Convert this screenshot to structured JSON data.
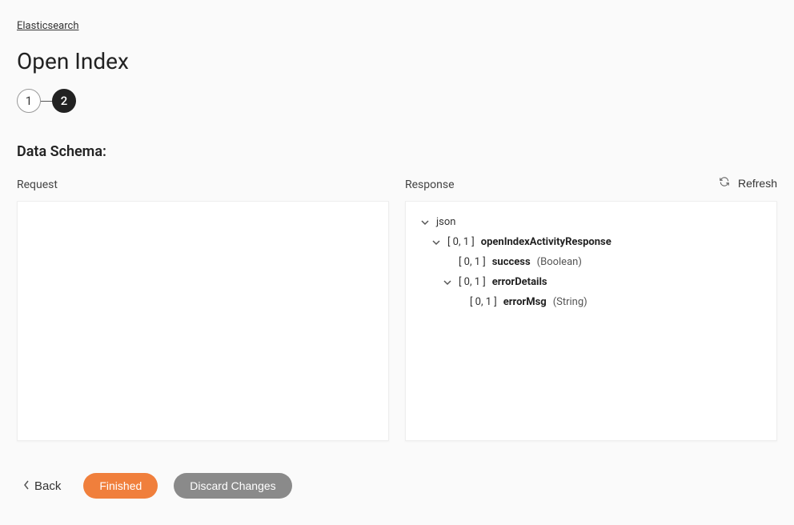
{
  "breadcrumb": "Elasticsearch",
  "page_title": "Open Index",
  "stepper": {
    "step1": "1",
    "step2": "2"
  },
  "section_heading": "Data Schema:",
  "refresh_label": "Refresh",
  "panels": {
    "request_label": "Request",
    "response_label": "Response"
  },
  "tree": {
    "root_label": "json",
    "node1_card": "[ 0, 1 ]",
    "node1_name": "openIndexActivityResponse",
    "node2_card": "[ 0, 1 ]",
    "node2_name": "success",
    "node2_type": "(Boolean)",
    "node3_card": "[ 0, 1 ]",
    "node3_name": "errorDetails",
    "node4_card": "[ 0, 1 ]",
    "node4_name": "errorMsg",
    "node4_type": "(String)"
  },
  "footer": {
    "back": "Back",
    "finished": "Finished",
    "discard": "Discard Changes"
  }
}
